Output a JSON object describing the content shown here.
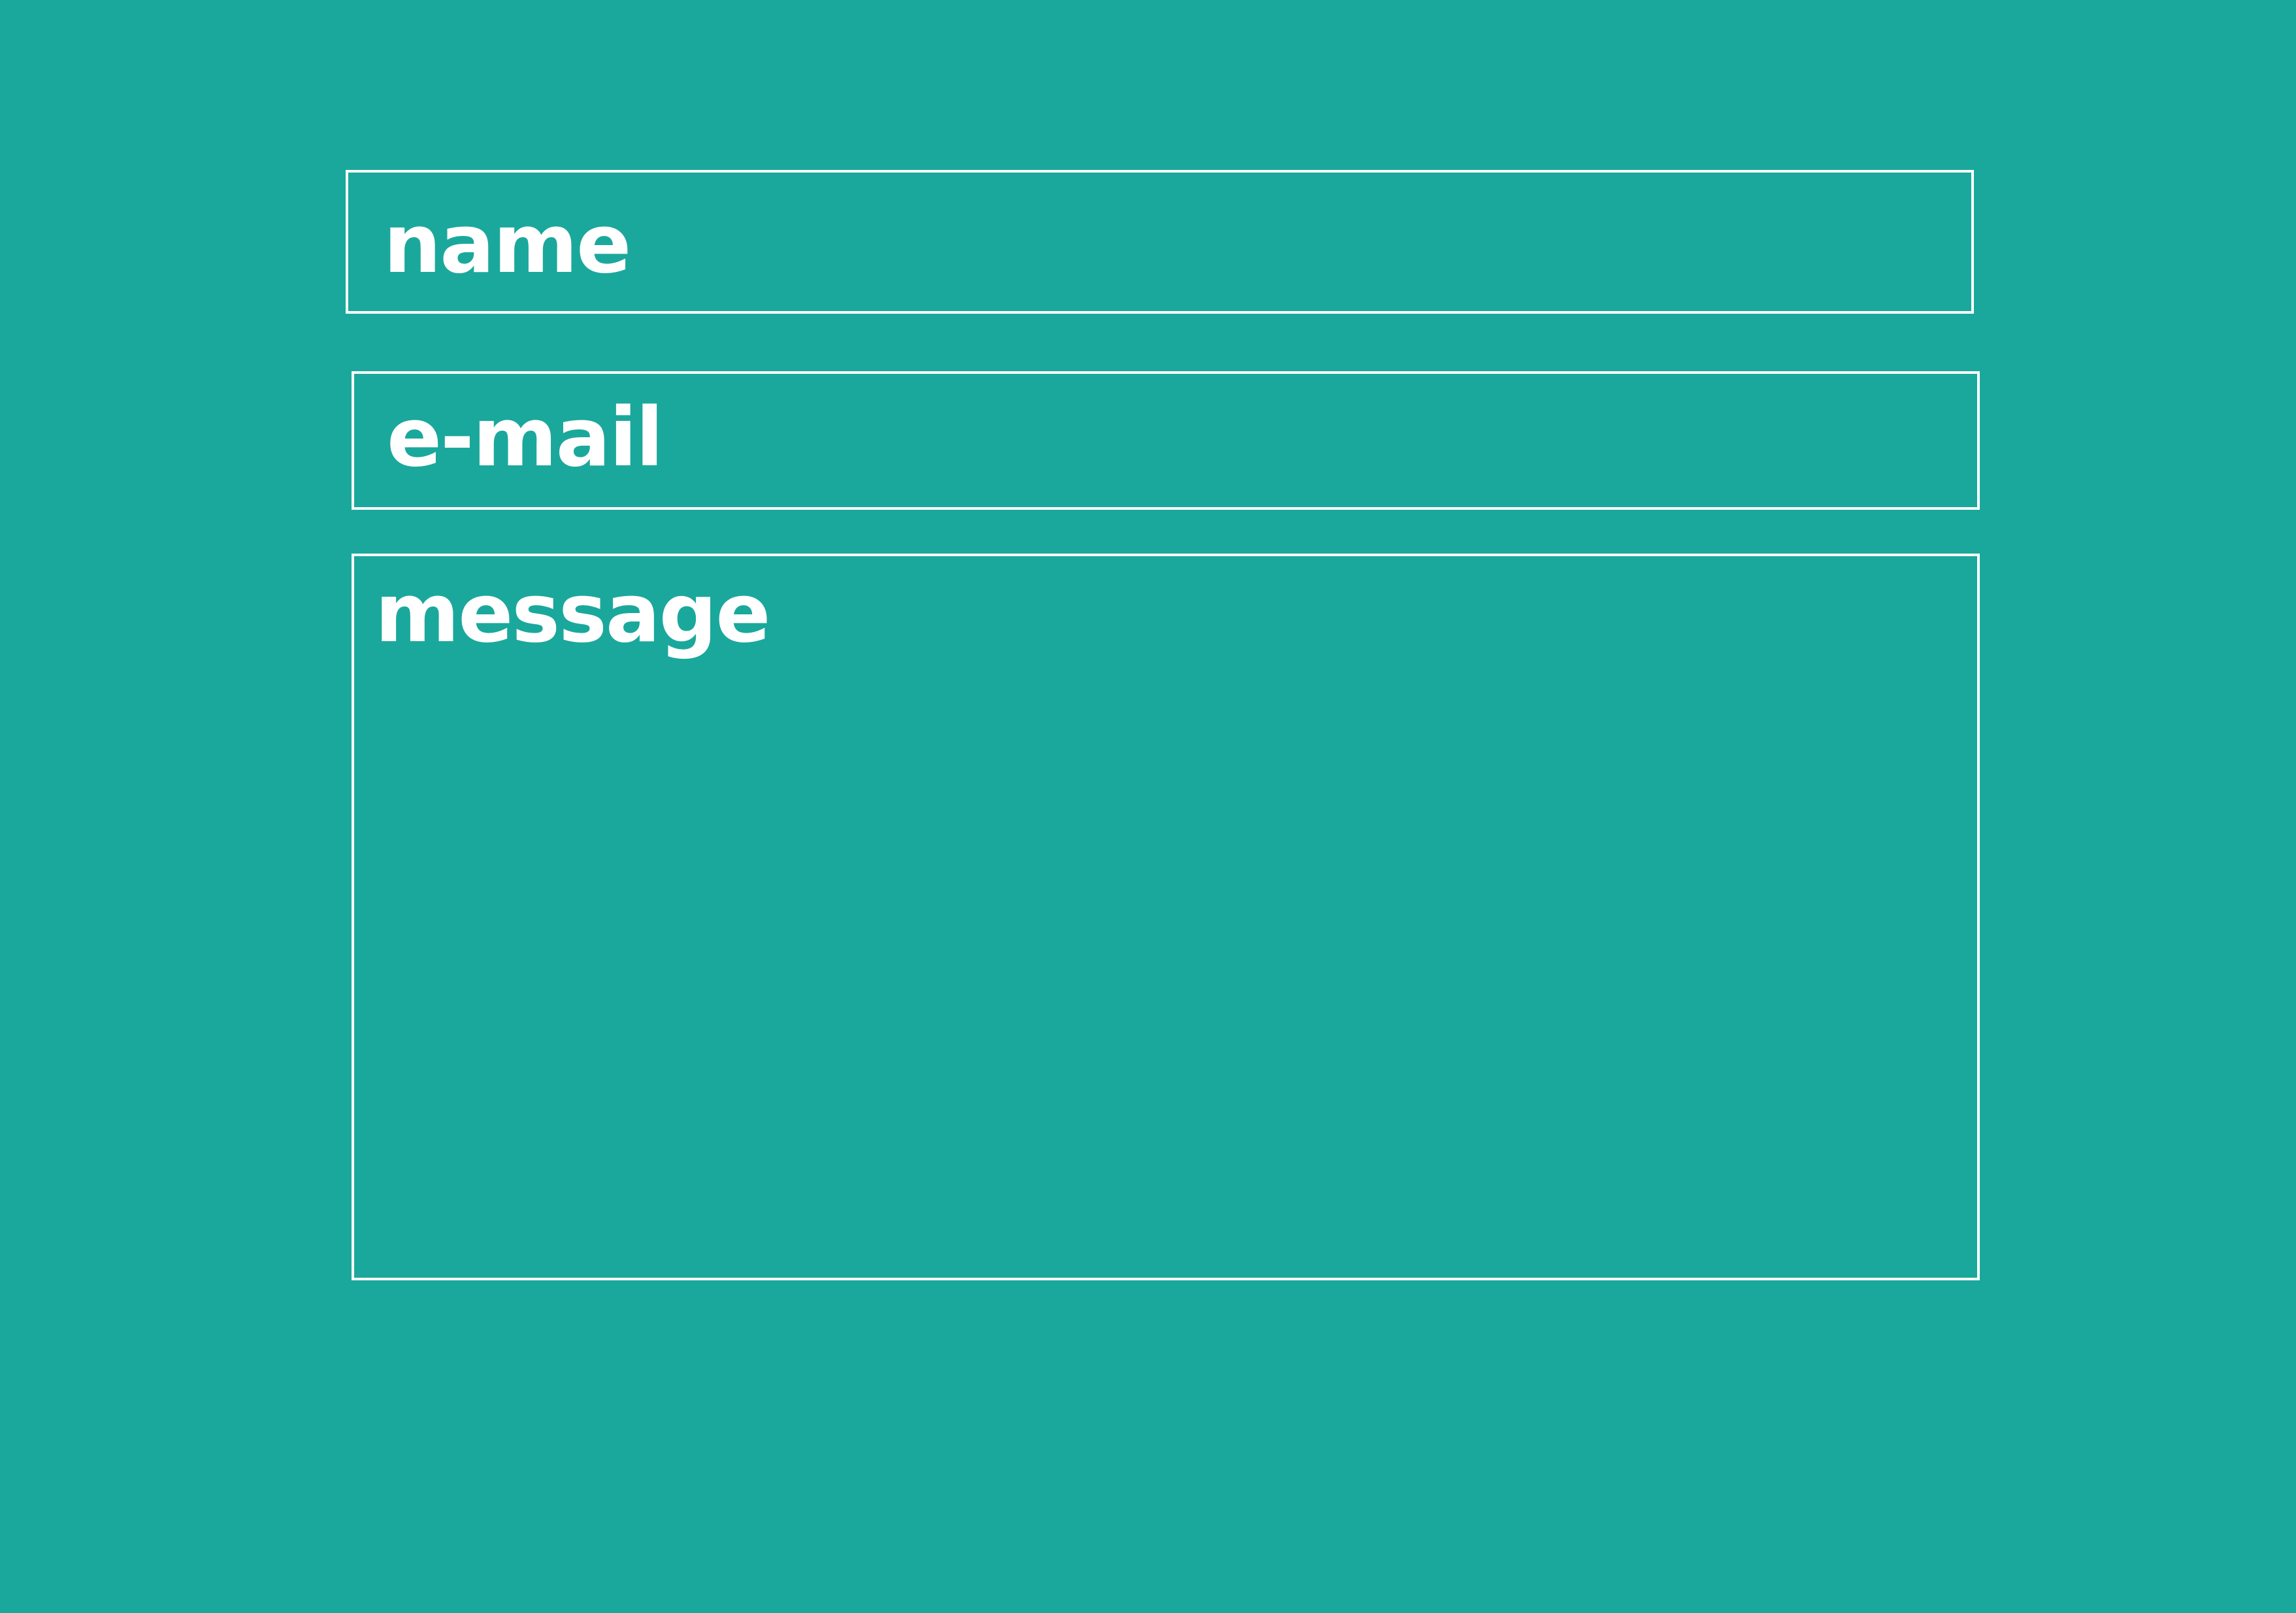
{
  "colors": {
    "background": "#1ba89c",
    "border": "#ffffff",
    "text": "#ffffff"
  },
  "form": {
    "name_placeholder": "name",
    "email_placeholder": "e-mail",
    "message_placeholder": "message"
  }
}
